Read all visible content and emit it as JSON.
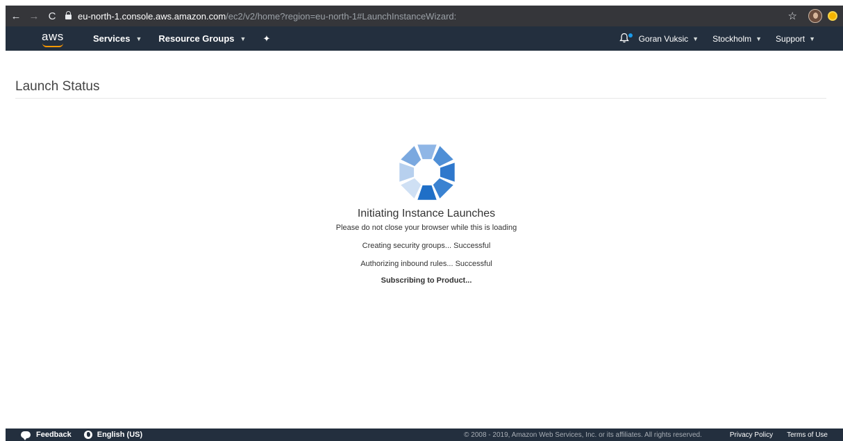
{
  "browser": {
    "back_icon": "←",
    "forward_icon": "→",
    "reload_icon": "C",
    "url_host": "eu-north-1.console.aws.amazon.com",
    "url_path": "/ec2/v2/home?region=eu-north-1#LaunchInstanceWizard:",
    "star_icon": "☆"
  },
  "nav": {
    "logo_text": "aws",
    "services_label": "Services",
    "resource_groups_label": "Resource Groups",
    "pin_icon": "✦",
    "bell_icon": "🔔",
    "user_label": "Goran Vuksic",
    "region_label": "Stockholm",
    "support_label": "Support",
    "caret": "▼"
  },
  "page": {
    "title": "Launch Status"
  },
  "status": {
    "title": "Initiating Instance Launches",
    "subtitle": "Please do not close your browser while this is loading",
    "steps": [
      "Creating security groups... Successful",
      "Authorizing inbound rules... Successful",
      "Subscribing to Product..."
    ]
  },
  "footer": {
    "feedback_label": "Feedback",
    "language_label": "English (US)",
    "copyright": "© 2008 - 2019, Amazon Web Services, Inc. or its affiliates. All rights reserved.",
    "privacy_label": "Privacy Policy",
    "terms_label": "Terms of Use"
  },
  "colors": {
    "nav_bg": "#232f3e",
    "accent_orange": "#ff9900",
    "spinner_dark": "#1f6fc7",
    "spinner_light": "#b7d0ee"
  }
}
